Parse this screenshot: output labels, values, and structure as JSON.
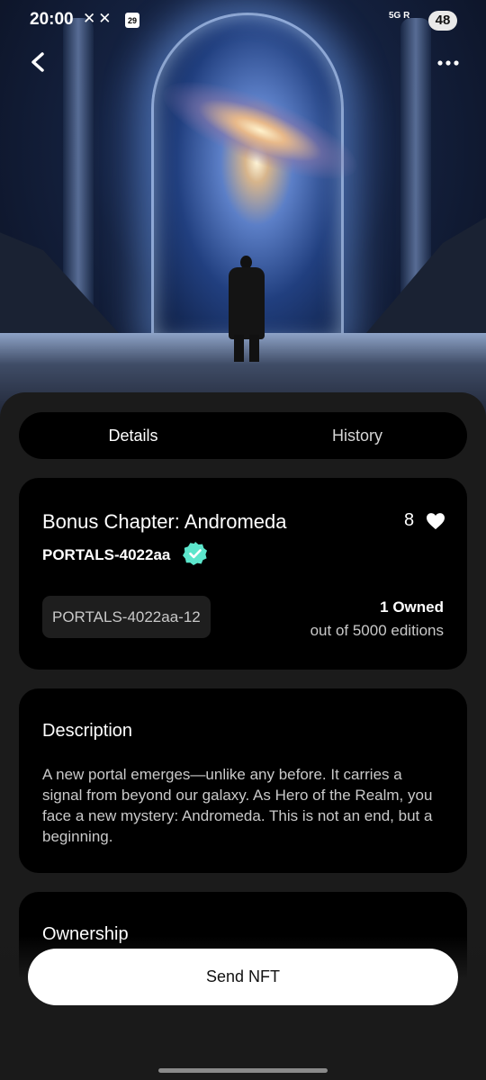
{
  "status_bar": {
    "time": "20:00",
    "notification_icons": "✕✕",
    "calendar_day": "29",
    "network": "5G",
    "signal_label": "R",
    "battery": "48"
  },
  "header": {
    "back_icon": "chevron-left-icon",
    "more_icon": "more-horizontal-icon"
  },
  "tabs": [
    {
      "label": "Details",
      "active": true
    },
    {
      "label": "History",
      "active": false
    }
  ],
  "nft": {
    "title": "Bonus Chapter: Andromeda",
    "likes": "8",
    "collection": "PORTALS-4022aa",
    "token_id": "PORTALS-4022aa-12",
    "owned": "1 Owned",
    "editions": "out of 5000 editions",
    "verified_color": "#5ce6cc"
  },
  "description": {
    "title": "Description",
    "text": "A new portal emerges—unlike any before. It carries a signal from beyond our galaxy. As Hero of the Realm, you face a new mystery: Andromeda. This is not an end, but a beginning."
  },
  "ownership": {
    "title": "Ownership"
  },
  "actions": {
    "send_label": "Send NFT"
  }
}
